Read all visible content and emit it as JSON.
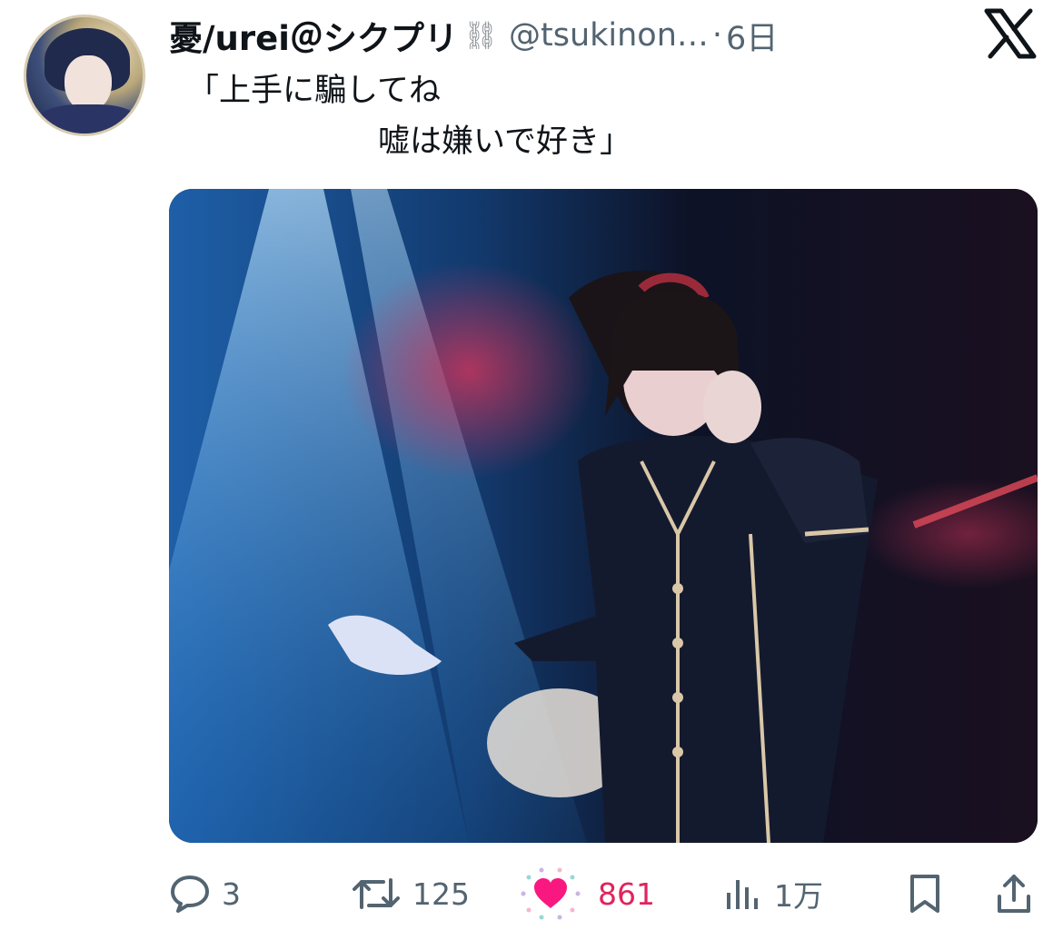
{
  "tweet": {
    "display_name": "憂/urei＠シクプリ",
    "name_emoji": "⛓",
    "handle": "@tsukinon…",
    "separator": "·",
    "timestamp": "6日",
    "text_line1": "「上手に騙してね",
    "text_line2": "　　　　　　嘘は嫌いで好き」"
  },
  "platform_icon": "x-logo-icon",
  "actions": {
    "reply_count": "3",
    "retweet_count": "125",
    "like_count": "861",
    "views_count": "1万"
  },
  "colors": {
    "like_active": "#f91880",
    "muted": "#536471"
  }
}
